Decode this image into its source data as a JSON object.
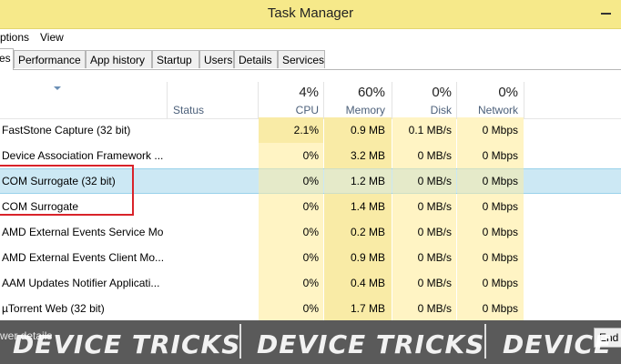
{
  "window": {
    "title": "Task Manager"
  },
  "menu": {
    "items": [
      "ptions",
      "View"
    ]
  },
  "tabs": [
    "es",
    "Performance",
    "App history",
    "Startup",
    "Users",
    "Details",
    "Services"
  ],
  "header": {
    "status": "Status",
    "cpu": {
      "pct": "4%",
      "label": "CPU"
    },
    "memory": {
      "pct": "60%",
      "label": "Memory"
    },
    "disk": {
      "pct": "0%",
      "label": "Disk"
    },
    "network": {
      "pct": "0%",
      "label": "Network"
    }
  },
  "processes": [
    {
      "name": "FastStone Capture (32 bit)",
      "cpu": "2.1%",
      "memory": "0.9 MB",
      "disk": "0.1 MB/s",
      "network": "0 Mbps"
    },
    {
      "name": "Device Association Framework ...",
      "cpu": "0%",
      "memory": "3.2 MB",
      "disk": "0 MB/s",
      "network": "0 Mbps"
    },
    {
      "name": "COM Surrogate (32 bit)",
      "cpu": "0%",
      "memory": "1.2 MB",
      "disk": "0 MB/s",
      "network": "0 Mbps"
    },
    {
      "name": "COM Surrogate",
      "cpu": "0%",
      "memory": "1.4 MB",
      "disk": "0 MB/s",
      "network": "0 Mbps"
    },
    {
      "name": "AMD External Events Service Mo...",
      "cpu": "0%",
      "memory": "0.2 MB",
      "disk": "0 MB/s",
      "network": "0 Mbps"
    },
    {
      "name": "AMD External Events Client Mo...",
      "cpu": "0%",
      "memory": "0.9 MB",
      "disk": "0 MB/s",
      "network": "0 Mbps"
    },
    {
      "name": "AAM Updates Notifier Applicati...",
      "cpu": "0%",
      "memory": "0.4 MB",
      "disk": "0 MB/s",
      "network": "0 Mbps"
    },
    {
      "name": "µTorrent Web (32 bit)",
      "cpu": "0%",
      "memory": "1.7 MB",
      "disk": "0 MB/s",
      "network": "0 Mbps"
    }
  ],
  "footer": {
    "fewer_details": "wer details",
    "end_task": "End"
  },
  "watermark": {
    "text": "DEVICE TRICKS",
    "partial": "DEVICE"
  },
  "colors": {
    "titlebar": "#f6e98a",
    "heat_light": "#fff4c4",
    "heat_medium": "#f9eba6",
    "heat_strong": "#f7e08a",
    "selection": "#cce8f4",
    "highlight_box": "#d9232a"
  }
}
